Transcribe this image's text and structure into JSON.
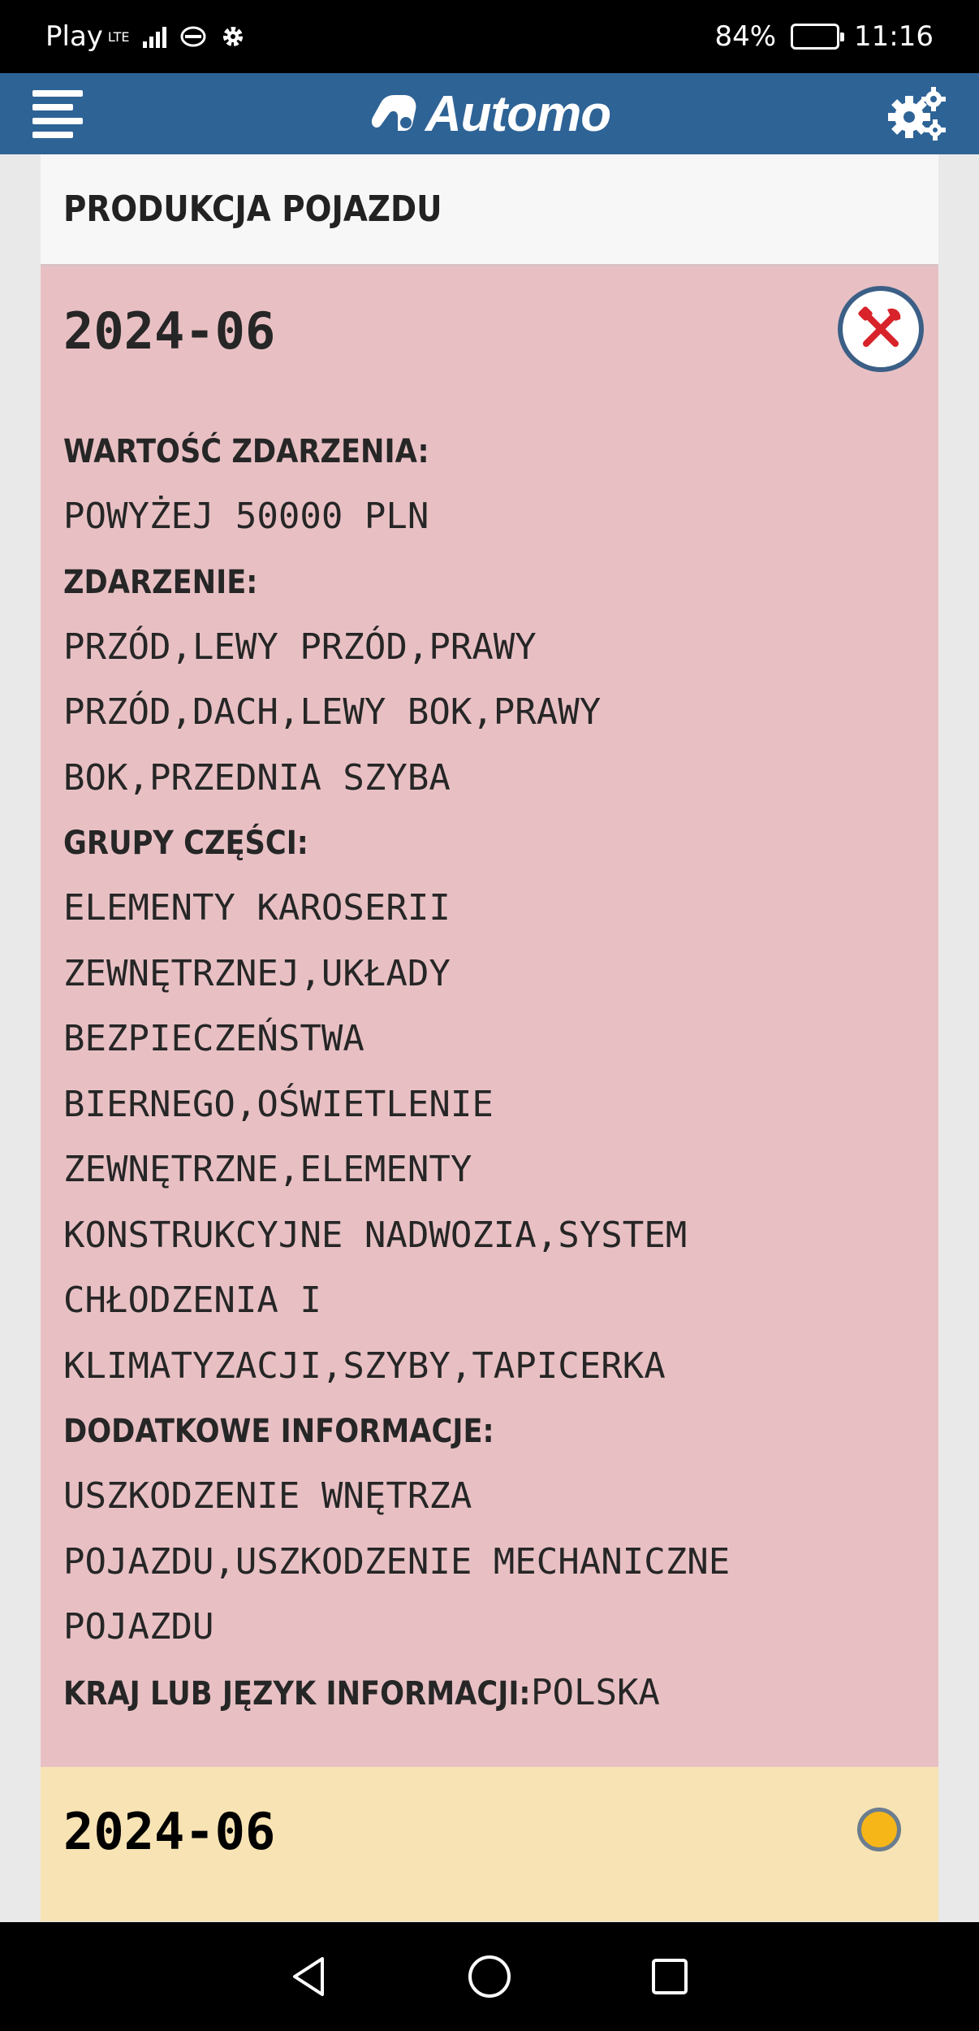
{
  "status_bar": {
    "carrier": "Play",
    "network": "LTE",
    "battery_percent": "84%",
    "battery_level": 0.84,
    "time": "11:16"
  },
  "app_bar": {
    "logo_text": "Automo",
    "menu_icon": "menu-icon",
    "settings_icon": "gears-icon"
  },
  "section": {
    "title": "PRODUKCJA POJAZDU"
  },
  "events": [
    {
      "date": "2024-06",
      "badge_icon": "tools-icon",
      "background": "#e8c0c4",
      "value_label": "WARTOŚĆ ZDARZENIA:",
      "value": "POWYŻEJ 50000 PLN",
      "event_label": "ZDARZENIE:",
      "event": "PRZÓD,LEWY PRZÓD,PRAWY\nPRZÓD,DACH,LEWY BOK,PRAWY\nBOK,PRZEDNIA SZYBA",
      "parts_label": "GRUPY CZĘŚCI:",
      "parts": "ELEMENTY KAROSERII\nZEWNĘTRZNEJ,UKŁADY\nBEZPIECZEŃSTWA\nBIERNEGO,OŚWIETLENIE\nZEWNĘTRZNE,ELEMENTY\nKONSTRUKCYJNE NADWOZIA,SYSTEM\nCHŁODZENIA I\nKLIMATYZACJI,SZYBY,TAPICERKA",
      "extra_label": "DODATKOWE INFORMACJE:",
      "extra": "USZKODZENIE WNĘTRZA\nPOJAZDU,USZKODZENIE MECHANICZNE\nPOJAZDU",
      "country_label": "KRAJ LUB JĘZYK INFORMACJI:",
      "country": "POLSKA"
    },
    {
      "date": "2024-06",
      "background": "#f7e3b3",
      "status_color": "#f7b617"
    }
  ],
  "nav_bar": {
    "back_icon": "back-triangle-icon",
    "home_icon": "home-circle-icon",
    "recents_icon": "recents-square-icon"
  }
}
